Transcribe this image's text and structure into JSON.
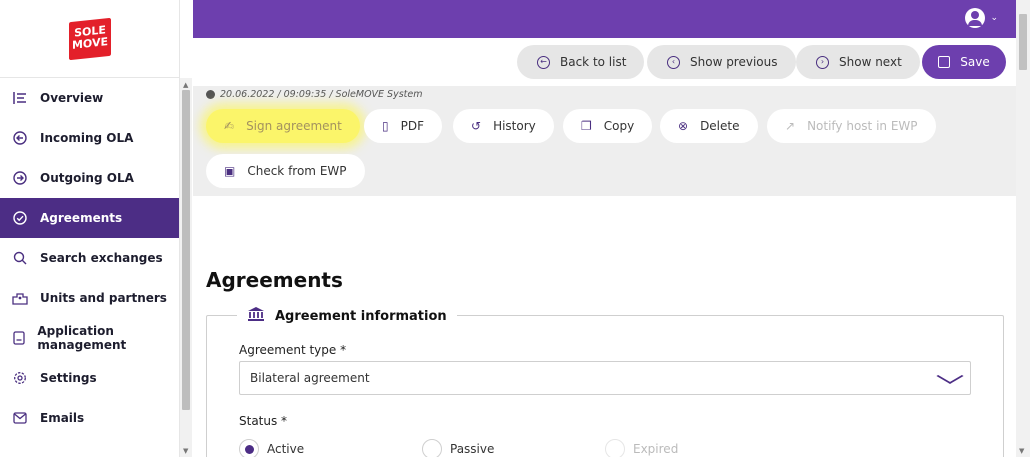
{
  "app": {
    "logo_line1": "SOLE",
    "logo_line2": "MOVE",
    "brand_color": "#6d3fae",
    "active_color": "#4c2d85"
  },
  "sidebar": {
    "items": [
      {
        "label": "Overview",
        "icon": "list-icon",
        "active": false
      },
      {
        "label": "Incoming OLA",
        "icon": "arrow-left-circle-icon",
        "active": false
      },
      {
        "label": "Outgoing OLA",
        "icon": "arrow-right-circle-icon",
        "active": false
      },
      {
        "label": "Agreements",
        "icon": "check-circle-icon",
        "active": true
      },
      {
        "label": "Search exchanges",
        "icon": "search-icon",
        "active": false
      },
      {
        "label": "Units and partners",
        "icon": "building-icon",
        "active": false
      },
      {
        "label": "Application management",
        "icon": "document-icon",
        "active": false
      },
      {
        "label": "Settings",
        "icon": "gear-icon",
        "active": false
      },
      {
        "label": "Emails",
        "icon": "mail-icon",
        "active": false
      }
    ]
  },
  "header": {
    "back_label": "Back to list",
    "previous_label": "Show previous",
    "next_label": "Show next",
    "save_label": "Save"
  },
  "meta": {
    "text": "20.06.2022 / 09:09:35 / SoleMOVE System"
  },
  "toolbar": {
    "sign_label": "Sign agreement",
    "pdf_label": "PDF",
    "history_label": "History",
    "copy_label": "Copy",
    "delete_label": "Delete",
    "notify_label": "Notify host in EWP",
    "check_label": "Check from EWP"
  },
  "main": {
    "title": "Agreements",
    "section_title": "Agreement information",
    "agreement_type_label": "Agreement type *",
    "agreement_type_value": "Bilateral agreement",
    "status_label": "Status *",
    "status_options": [
      {
        "label": "Active",
        "checked": true,
        "disabled": false
      },
      {
        "label": "Passive",
        "checked": false,
        "disabled": false
      },
      {
        "label": "Expired",
        "checked": false,
        "disabled": true
      }
    ]
  }
}
